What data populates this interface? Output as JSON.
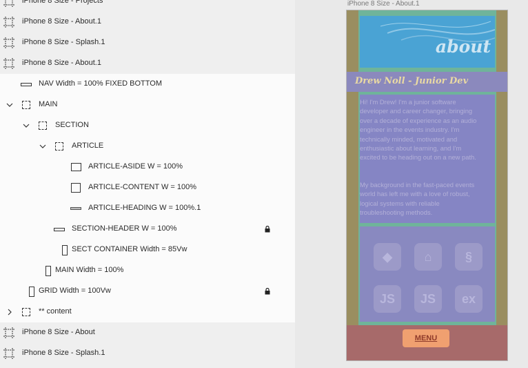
{
  "layers": [
    {
      "label": "iPhone 8 Size - Projects",
      "icon": "artboard-icon",
      "depth": 0,
      "selected": false,
      "chevron": "none"
    },
    {
      "label": "iPhone 8 Size - About.1",
      "icon": "artboard-icon",
      "depth": 0,
      "selected": false,
      "chevron": "none"
    },
    {
      "label": "iPhone 8 Size - Splash.1",
      "icon": "artboard-icon",
      "depth": 0,
      "selected": false,
      "chevron": "none"
    },
    {
      "label": "iPhone 8 Size - About.1",
      "icon": "artboard-icon",
      "depth": 0,
      "selected": false,
      "chevron": "none"
    },
    {
      "label": "NAV Width = 100% FIXED BOTTOM",
      "icon": "rectangle-wide-icon",
      "depth": 1,
      "selected": true,
      "chevron": "none"
    },
    {
      "label": "MAIN",
      "icon": "group-icon",
      "depth": 1,
      "selected": true,
      "chevron": "down"
    },
    {
      "label": "SECTION",
      "icon": "group-icon",
      "depth": 2,
      "selected": true,
      "chevron": "down"
    },
    {
      "label": "ARTICLE",
      "icon": "group-icon",
      "depth": 3,
      "selected": true,
      "chevron": "down"
    },
    {
      "label": "ARTICLE-ASIDE W = 100%",
      "icon": "rectangle-icon",
      "depth": 4,
      "selected": true,
      "chevron": "none"
    },
    {
      "label": "ARTICLE-CONTENT W = 100%",
      "icon": "rectangle-square-icon",
      "depth": 4,
      "selected": true,
      "chevron": "none"
    },
    {
      "label": "ARTICLE-HEADING W = 100%.1",
      "icon": "rectangle-thin-icon",
      "depth": 4,
      "selected": true,
      "chevron": "none"
    },
    {
      "label": "SECTION-HEADER W = 100%",
      "icon": "rectangle-wide-icon",
      "depth": 3,
      "selected": true,
      "chevron": "none",
      "locked": true
    },
    {
      "label": "SECT CONTAINER Width = 85Vw",
      "icon": "rectangle-tall-icon",
      "depth": 3,
      "selected": true,
      "chevron": "none"
    },
    {
      "label": "MAIN Width = 100%",
      "icon": "rectangle-tall-icon",
      "depth": 2,
      "selected": true,
      "chevron": "none"
    },
    {
      "label": "GRID Width = 100Vw",
      "icon": "rectangle-tall-icon",
      "depth": 1,
      "selected": true,
      "chevron": "none",
      "locked": true
    },
    {
      "label": "** content",
      "icon": "group-icon",
      "depth": 1,
      "selected": true,
      "chevron": "right"
    },
    {
      "label": "iPhone 8 Size - About",
      "icon": "artboard-icon",
      "depth": 0,
      "selected": false,
      "chevron": "none"
    },
    {
      "label": "iPhone 8 Size - Splash.1",
      "icon": "artboard-icon",
      "depth": 0,
      "selected": false,
      "chevron": "none"
    }
  ],
  "artboard": {
    "title": "iPhone 8 Size - About.1",
    "hero_title": "about",
    "heading": "Drew Noll - Junior Dev",
    "paragraphs": [
      "Hi! I'm Drew! I'm a junior software developer and career changer, bringing over a decade of experience as an audio engineer in the events industry. I'm technically minded, motivated and enthusiastic about learning, and I'm excited to be heading out on a new path.",
      "My background in the fast-paced events world has left me with a love of robust, logical systems with reliable troubleshooting methods."
    ],
    "tech_icons": [
      {
        "name": "ruby-icon",
        "glyph": "◆"
      },
      {
        "name": "rails-icon",
        "glyph": "⌂"
      },
      {
        "name": "python-icon",
        "glyph": "§"
      },
      {
        "name": "javascript-icon",
        "glyph": "JS"
      },
      {
        "name": "nodejs-icon",
        "glyph": "JS"
      },
      {
        "name": "express-icon",
        "glyph": "ex"
      }
    ],
    "menu_label": "MENU"
  },
  "colors": {
    "panel_bg": "#efefef",
    "selected_row_bg": "#fbfbfb",
    "grid_overlay": "#8585c4",
    "nav_overlay": "#a76a6a",
    "menu_button": "#f0a070"
  }
}
